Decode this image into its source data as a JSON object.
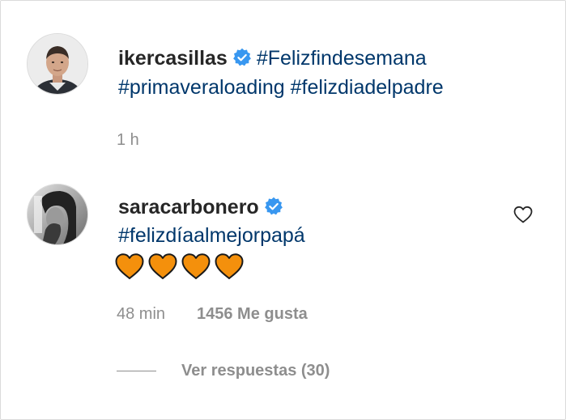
{
  "post": {
    "username": "ikercasillas",
    "verified": true,
    "hashtags_line1": [
      "#Felizfindesemana"
    ],
    "hashtags_line2": [
      "#primaveraloading",
      "#felizdiadelpadre"
    ],
    "time": "1 h"
  },
  "comment": {
    "username": "saracarbonero",
    "verified": true,
    "hashtag": "#felizdíaalmejorpapá",
    "emoji_hearts": 4,
    "time": "48 min",
    "likes": "1456 Me gusta",
    "view_replies": "Ver respuestas (30)"
  },
  "icons": {
    "verified": "verified-badge-icon",
    "like": "heart-outline-icon",
    "emoji": "orange-heart-emoji"
  },
  "colors": {
    "hashtag": "#00376b",
    "verified": "#3897f0",
    "muted": "#8e8e8e",
    "text": "#262626",
    "emoji_heart": "#f4900c"
  }
}
